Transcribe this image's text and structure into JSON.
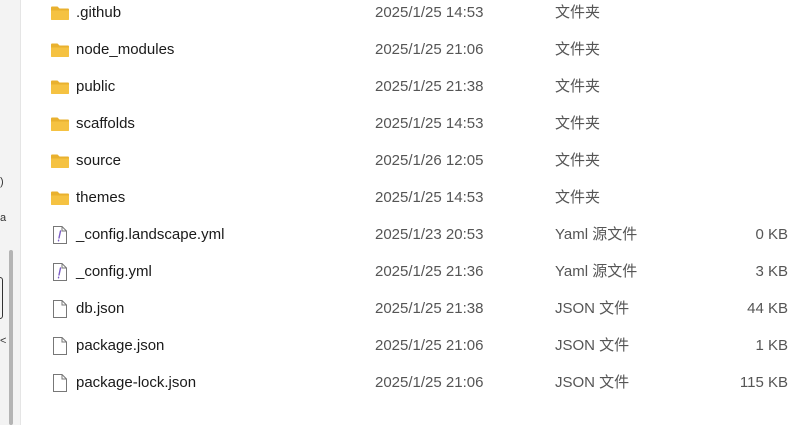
{
  "left_pane": {
    "fragments": [
      ")",
      "a",
      "<"
    ]
  },
  "files": [
    {
      "name": ".github",
      "date": "2025/1/25 14:53",
      "type": "文件夹",
      "size": "",
      "icon": "folder-icon"
    },
    {
      "name": "node_modules",
      "date": "2025/1/25 21:06",
      "type": "文件夹",
      "size": "",
      "icon": "folder-icon"
    },
    {
      "name": "public",
      "date": "2025/1/25 21:38",
      "type": "文件夹",
      "size": "",
      "icon": "folder-icon"
    },
    {
      "name": "scaffolds",
      "date": "2025/1/25 14:53",
      "type": "文件夹",
      "size": "",
      "icon": "folder-icon"
    },
    {
      "name": "source",
      "date": "2025/1/26 12:05",
      "type": "文件夹",
      "size": "",
      "icon": "folder-icon"
    },
    {
      "name": "themes",
      "date": "2025/1/25 14:53",
      "type": "文件夹",
      "size": "",
      "icon": "folder-icon"
    },
    {
      "name": "_config.landscape.yml",
      "date": "2025/1/23 20:53",
      "type": "Yaml 源文件",
      "size": "0 KB",
      "icon": "yaml-file-icon"
    },
    {
      "name": "_config.yml",
      "date": "2025/1/25 21:36",
      "type": "Yaml 源文件",
      "size": "3 KB",
      "icon": "yaml-file-icon"
    },
    {
      "name": "db.json",
      "date": "2025/1/25 21:38",
      "type": "JSON 文件",
      "size": "44 KB",
      "icon": "file-icon"
    },
    {
      "name": "package.json",
      "date": "2025/1/25 21:06",
      "type": "JSON 文件",
      "size": "1 KB",
      "icon": "file-icon"
    },
    {
      "name": "package-lock.json",
      "date": "2025/1/25 21:06",
      "type": "JSON 文件",
      "size": "115 KB",
      "icon": "file-icon"
    }
  ],
  "colors": {
    "folder": "#F5C242",
    "folder_dark": "#E9B12F",
    "yaml_mark": "#7B5CC4",
    "file_outline": "#777777"
  }
}
